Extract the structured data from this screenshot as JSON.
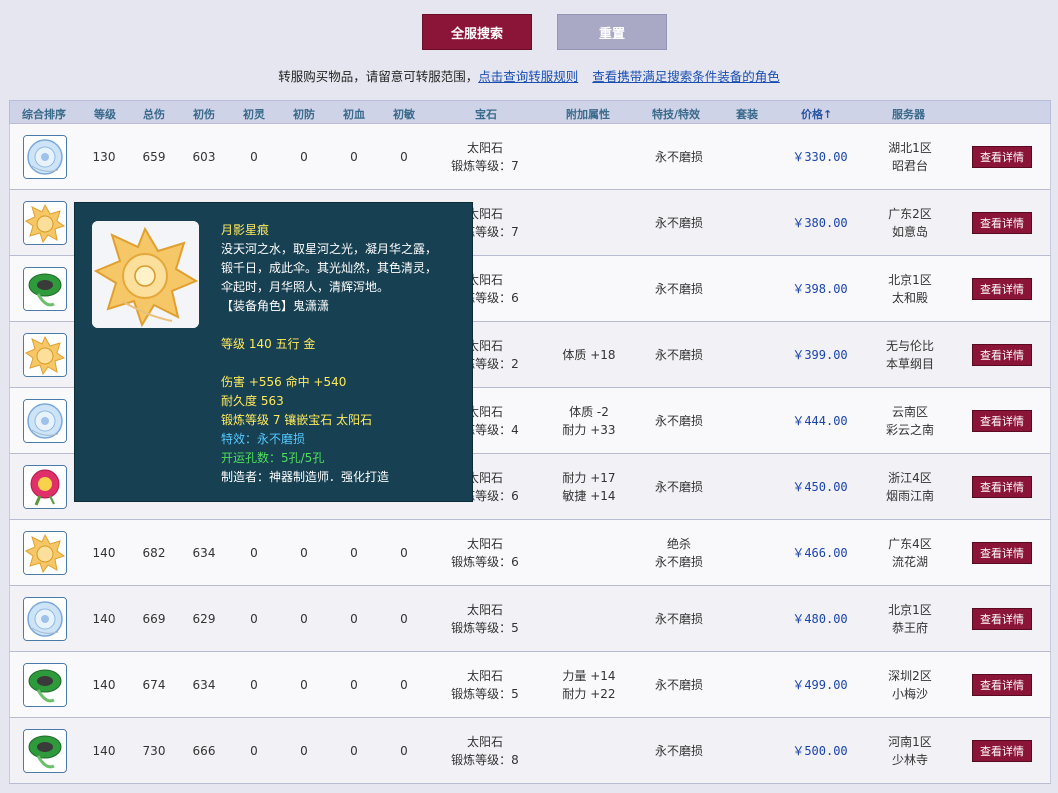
{
  "buttons": {
    "search": "全服搜索",
    "reset": "重置"
  },
  "notice": {
    "text": "转服购买物品，请留意可转服范围，",
    "link1": "点击查询转服规则",
    "link2": "查看携带满足搜索条件装备的角色"
  },
  "headers": [
    "综合排序",
    "等级",
    "总伤",
    "初伤",
    "初灵",
    "初防",
    "初血",
    "初敏",
    "宝石",
    "附加属性",
    "特技/特效",
    "套装",
    "价格↑",
    "服务器"
  ],
  "detail_label": "查看详情",
  "rows": [
    {
      "icon": "blue-umbrella-icon",
      "level": "130",
      "total": "659",
      "init": "603",
      "spirit": "0",
      "def": "0",
      "hp": "0",
      "agi": "0",
      "gem1": "太阳石",
      "gem2": "锻炼等级：7",
      "attr1": "",
      "attr2": "",
      "eff1": "永不磨损",
      "eff2": "",
      "set": "",
      "price": "￥330.00",
      "server1": "湖北1区",
      "server2": "昭君台"
    },
    {
      "icon": "gold-umbrella-icon",
      "level": "",
      "total": "",
      "init": "",
      "spirit": "",
      "def": "",
      "hp": "",
      "agi": "",
      "gem1": "太阳石",
      "gem2": "锻炼等级：7",
      "attr1": "",
      "attr2": "",
      "eff1": "永不磨损",
      "eff2": "",
      "set": "",
      "price": "￥380.00",
      "server1": "广东2区",
      "server2": "如意岛"
    },
    {
      "icon": "green-umbrella-icon",
      "level": "",
      "total": "",
      "init": "",
      "spirit": "",
      "def": "",
      "hp": "",
      "agi": "",
      "gem1": "太阳石",
      "gem2": "锻炼等级：6",
      "attr1": "",
      "attr2": "",
      "eff1": "永不磨损",
      "eff2": "",
      "set": "",
      "price": "￥398.00",
      "server1": "北京1区",
      "server2": "太和殿"
    },
    {
      "icon": "gold-umbrella-icon",
      "level": "",
      "total": "",
      "init": "",
      "spirit": "",
      "def": "",
      "hp": "",
      "agi": "",
      "gem1": "太阳石",
      "gem2": "锻炼等级：2",
      "attr1": "体质 +18",
      "attr2": "",
      "eff1": "永不磨损",
      "eff2": "",
      "set": "",
      "price": "￥399.00",
      "server1": "无与伦比",
      "server2": "本草纲目"
    },
    {
      "icon": "blue-umbrella-icon",
      "level": "",
      "total": "",
      "init": "",
      "spirit": "",
      "def": "",
      "hp": "",
      "agi": "",
      "gem1": "太阳石",
      "gem2": "锻炼等级：4",
      "attr1": "体质 -2",
      "attr2": "耐力 +33",
      "eff1": "永不磨损",
      "eff2": "",
      "set": "",
      "price": "￥444.00",
      "server1": "云南区",
      "server2": "彩云之南"
    },
    {
      "icon": "red-umbrella-icon",
      "level": "",
      "total": "",
      "init": "",
      "spirit": "",
      "def": "",
      "hp": "",
      "agi": "",
      "gem1": "太阳石",
      "gem2": "锻炼等级：6",
      "attr1": "耐力 +17",
      "attr2": "敏捷 +14",
      "eff1": "永不磨损",
      "eff2": "",
      "set": "",
      "price": "￥450.00",
      "server1": "浙江4区",
      "server2": "烟雨江南"
    },
    {
      "icon": "gold-umbrella-icon",
      "level": "140",
      "total": "682",
      "init": "634",
      "spirit": "0",
      "def": "0",
      "hp": "0",
      "agi": "0",
      "gem1": "太阳石",
      "gem2": "锻炼等级：6",
      "attr1": "",
      "attr2": "",
      "eff1": "绝杀",
      "eff2": "永不磨损",
      "set": "",
      "price": "￥466.00",
      "server1": "广东4区",
      "server2": "流花湖"
    },
    {
      "icon": "blue-umbrella-icon",
      "level": "140",
      "total": "669",
      "init": "629",
      "spirit": "0",
      "def": "0",
      "hp": "0",
      "agi": "0",
      "gem1": "太阳石",
      "gem2": "锻炼等级：5",
      "attr1": "",
      "attr2": "",
      "eff1": "永不磨损",
      "eff2": "",
      "set": "",
      "price": "￥480.00",
      "server1": "北京1区",
      "server2": "恭王府"
    },
    {
      "icon": "green-umbrella-icon",
      "level": "140",
      "total": "674",
      "init": "634",
      "spirit": "0",
      "def": "0",
      "hp": "0",
      "agi": "0",
      "gem1": "太阳石",
      "gem2": "锻炼等级：5",
      "attr1": "力量 +14",
      "attr2": "耐力 +22",
      "eff1": "永不磨损",
      "eff2": "",
      "set": "",
      "price": "￥499.00",
      "server1": "深圳2区",
      "server2": "小梅沙"
    },
    {
      "icon": "green-umbrella-icon",
      "level": "140",
      "total": "730",
      "init": "666",
      "spirit": "0",
      "def": "0",
      "hp": "0",
      "agi": "0",
      "gem1": "太阳石",
      "gem2": "锻炼等级：8",
      "attr1": "",
      "attr2": "",
      "eff1": "永不磨损",
      "eff2": "",
      "set": "",
      "price": "￥500.00",
      "server1": "河南1区",
      "server2": "少林寺"
    }
  ],
  "tooltip": {
    "name": "月影星痕",
    "desc": [
      "没天河之水，取星河之光，凝月华之露，",
      "锻千日，成此伞。其光灿然，其色清灵，",
      "伞起时，月华照人，清辉泻地。",
      "【装备角色】鬼潇潇"
    ],
    "level_line": "等级 140 五行 金",
    "attack_line": "伤害 +556 命中 +540",
    "durability_line": "耐久度 563",
    "forge_line": "锻炼等级 7 镶嵌宝石 太阳石",
    "effect_line": "特效：永不磨损",
    "holes_line": "开运孔数：5孔/5孔",
    "maker_line": "制造者：神器制造师．强化打造"
  },
  "colors": {
    "accent": "#8a1538",
    "reset": "#a9a9c6",
    "tooltip_bg": "#174052"
  }
}
